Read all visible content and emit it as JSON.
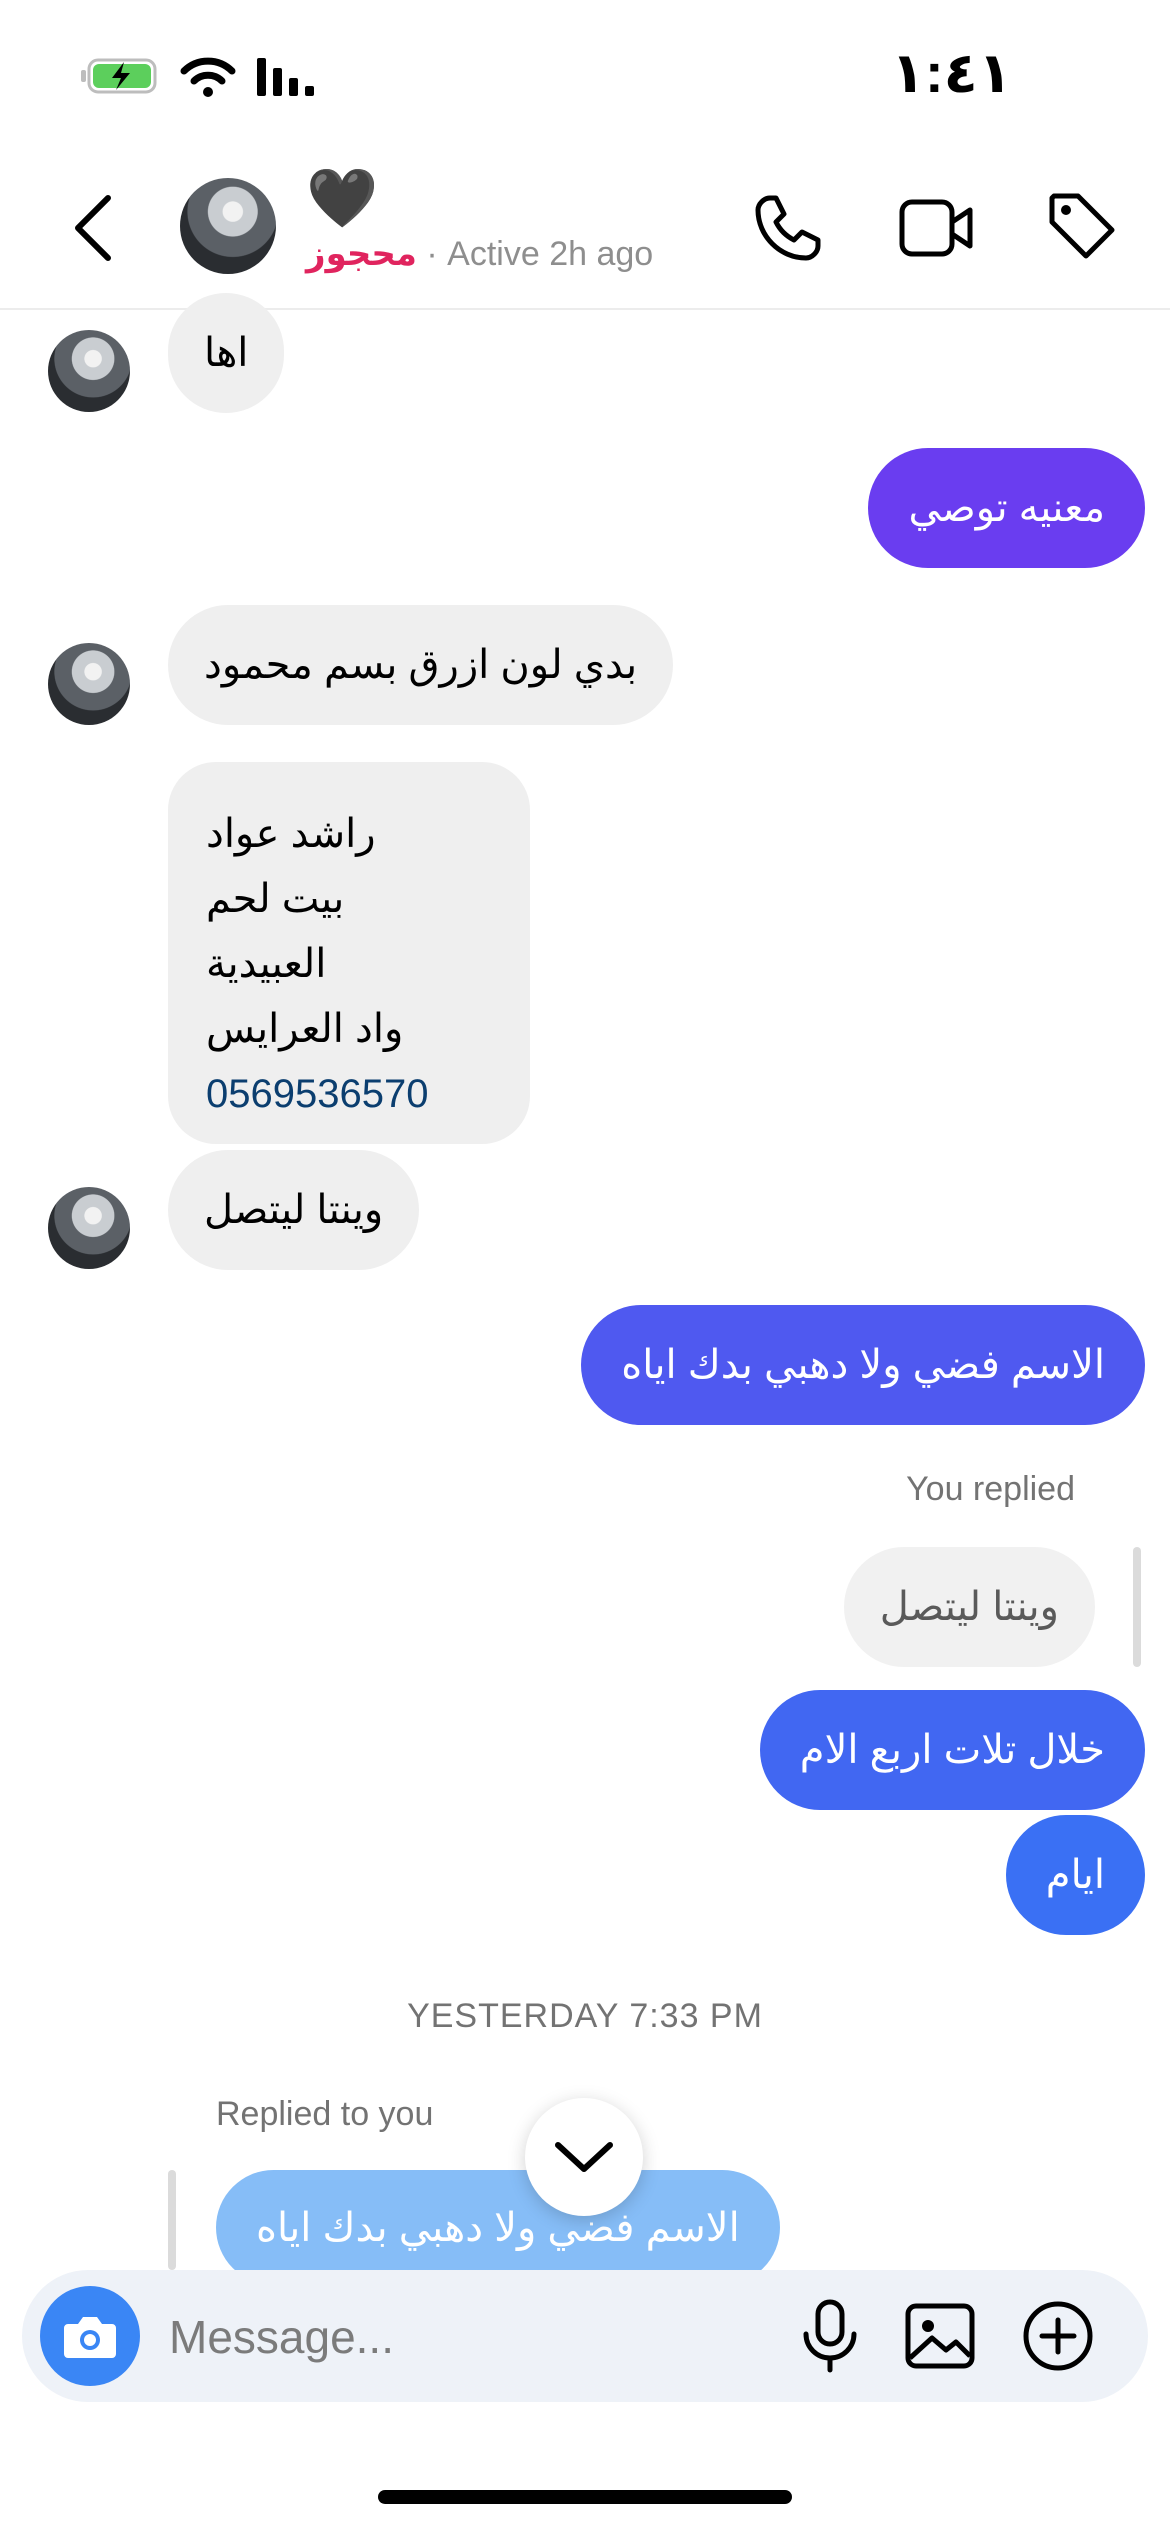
{
  "status_bar": {
    "time": "١:٤١",
    "battery_icon": "battery-charging-icon",
    "wifi_icon": "wifi-icon",
    "signal_icon": "cellular-signal-icon"
  },
  "header": {
    "avatar_icon": "profile-avatar",
    "heart": "🖤",
    "name": "محجوز",
    "separator": " · ",
    "status": "Active 2h ago",
    "icons": [
      "back-chevron-icon",
      "phone-icon",
      "video-camera-icon",
      "tag-icon"
    ]
  },
  "messages": [
    {
      "side": "in",
      "text": "اها"
    },
    {
      "side": "out",
      "text": "معنيه توصي",
      "color": "#6a3df0"
    },
    {
      "side": "in",
      "text": "بدي  لون ازرق بسم  محمود"
    },
    {
      "side": "in",
      "lines": [
        "راشد عواد",
        "بيت لحم",
        "العبيدية",
        "واد العرايس"
      ],
      "phone": "0569536570"
    },
    {
      "side": "in",
      "text": "وينتا ليتصل"
    },
    {
      "side": "out",
      "text": "الاسم فضي ولا دهبي بدك اياه",
      "color": "#4f59f0"
    },
    {
      "side": "reply",
      "label": "You replied",
      "quoted": "وينتا ليتصل"
    },
    {
      "side": "out",
      "text": "خلال تلات اربع الام",
      "color": "#4167f2"
    },
    {
      "side": "out",
      "text": "ايام",
      "color": "#3a70f4"
    },
    {
      "side": "timestamp",
      "text": "YESTERDAY 7:33 PM"
    },
    {
      "side": "reply-in",
      "label": "Replied to you",
      "quoted": "الاسم فضي ولا دهبي بدك اياه",
      "color": "#86bdf7"
    }
  ],
  "scroll_down_icon": "chevron-down-icon",
  "composer": {
    "placeholder": "Message...",
    "icons": [
      "camera-icon",
      "microphone-icon",
      "image-gallery-icon",
      "plus-circle-icon"
    ]
  }
}
